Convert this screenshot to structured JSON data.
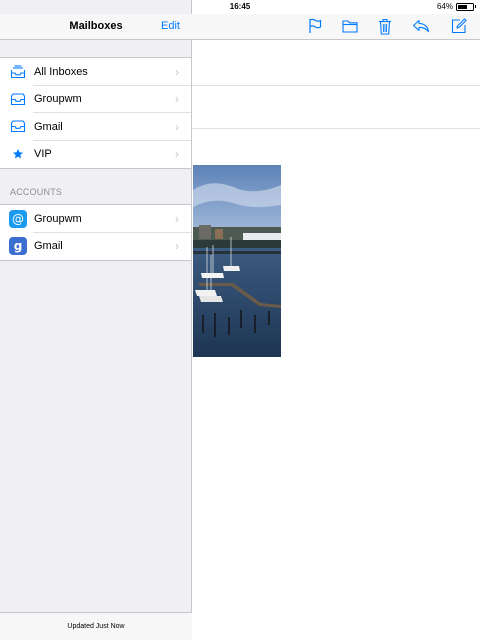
{
  "status_bar": {
    "time": "16:45",
    "battery_text": "64%",
    "battery_level": 0.64,
    "signal_bars": 3
  },
  "sidebar": {
    "title": "Mailboxes",
    "edit_label": "Edit",
    "mailboxes": [
      {
        "label": "All Inboxes",
        "icon": "inboxes-icon"
      },
      {
        "label": "Groupwm",
        "icon": "inbox-icon"
      },
      {
        "label": "Gmail",
        "icon": "inbox-icon"
      },
      {
        "label": "VIP",
        "icon": "star-icon"
      }
    ],
    "accounts_header": "ACCOUNTS",
    "accounts": [
      {
        "label": "Groupwm",
        "icon": "at-sign-icon"
      },
      {
        "label": "Gmail",
        "icon": "google-icon"
      }
    ],
    "footer_status": "Updated Just Now"
  },
  "toolbar": {
    "icons": [
      "flag-icon",
      "folder-icon",
      "trash-icon",
      "reply-icon",
      "compose-icon"
    ]
  },
  "colors": {
    "accent": "#007aff",
    "sidebar_bg": "#efeff4",
    "bar_bg": "#f7f7f7",
    "separator": "#c8c7cc"
  }
}
